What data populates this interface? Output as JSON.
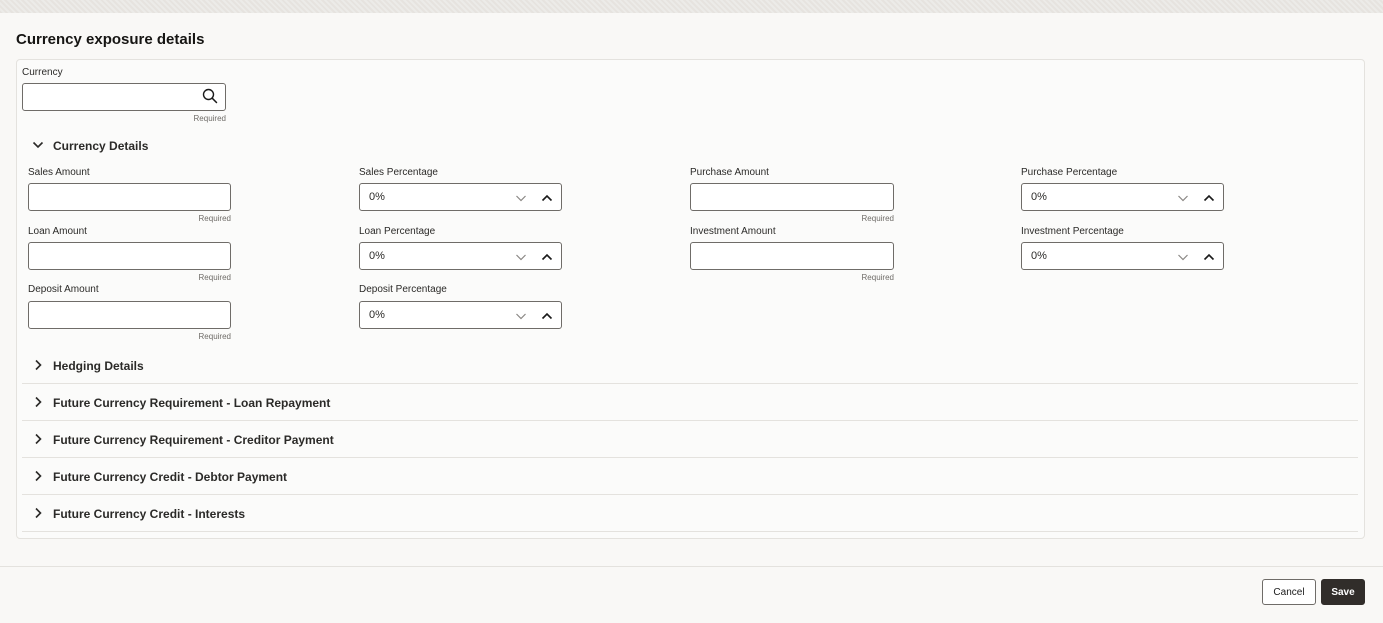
{
  "page": {
    "title": "Currency exposure details"
  },
  "currency": {
    "label": "Currency",
    "value": "",
    "required": "Required"
  },
  "currency_details": {
    "title": "Currency Details",
    "sales_amount": {
      "label": "Sales Amount",
      "value": "",
      "required": "Required"
    },
    "sales_percentage": {
      "label": "Sales Percentage",
      "value": "0%"
    },
    "purchase_amount": {
      "label": "Purchase Amount",
      "value": "",
      "required": "Required"
    },
    "purchase_percentage": {
      "label": "Purchase Percentage",
      "value": "0%"
    },
    "loan_amount": {
      "label": "Loan Amount",
      "value": "",
      "required": "Required"
    },
    "loan_percentage": {
      "label": "Loan Percentage",
      "value": "0%"
    },
    "investment_amount": {
      "label": "Investment Amount",
      "value": "",
      "required": "Required"
    },
    "investment_percentage": {
      "label": "Investment Percentage",
      "value": "0%"
    },
    "deposit_amount": {
      "label": "Deposit Amount",
      "value": "",
      "required": "Required"
    },
    "deposit_percentage": {
      "label": "Deposit Percentage",
      "value": "0%"
    }
  },
  "sections": [
    {
      "title": "Hedging Details"
    },
    {
      "title": "Future Currency Requirement - Loan Repayment"
    },
    {
      "title": "Future Currency Requirement - Creditor Payment"
    },
    {
      "title": "Future Currency Credit - Debtor Payment"
    },
    {
      "title": "Future Currency Credit - Interests"
    }
  ],
  "footer": {
    "cancel_label": "Cancel",
    "save_label": "Save"
  },
  "icons": {
    "search": "search-icon",
    "expanded": "chevron-down-icon",
    "collapsed": "chevron-right-icon",
    "dropdown": "chevron-down-icon",
    "spinner": "chevron-up-icon"
  },
  "colors": {
    "primary_button": "#312d2a",
    "border": "#6f6c68"
  }
}
